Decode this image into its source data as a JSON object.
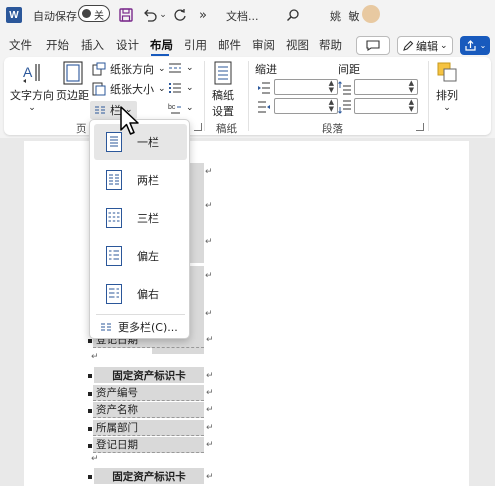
{
  "titlebar": {
    "app_logo": "W",
    "autosave_label": "自动保存",
    "autosave_state": "关",
    "doc_title": "文档...",
    "user_name": "姚 敏",
    "more_glyph": "»",
    "icons": [
      "save-icon",
      "undo-icon",
      "redo-icon",
      "search-icon"
    ]
  },
  "tabs": [
    "文件",
    "开始",
    "插入",
    "设计",
    "布局",
    "引用",
    "邮件",
    "审阅",
    "视图",
    "帮助"
  ],
  "active_tab": "布局",
  "top_buttons": {
    "edit_label": "编辑"
  },
  "ribbon": {
    "text_direction": "文字方向",
    "margins": "页边距",
    "orientation": "纸张方向",
    "size": "纸张大小",
    "columns": "栏",
    "page_setup_label": "页",
    "draft_paper": "稿纸\n设置",
    "draft_paper_line1": "稿纸",
    "draft_paper_line2": "设置",
    "draft_group_label": "稿纸",
    "indent_label": "缩进",
    "spacing_label": "间距",
    "paragraph_label": "段落",
    "arrange_label": "排列"
  },
  "columns_menu": {
    "items": [
      {
        "label": "一栏",
        "selected": true
      },
      {
        "label": "两栏",
        "selected": false
      },
      {
        "label": "三栏",
        "selected": false
      },
      {
        "label": "偏左",
        "selected": false
      },
      {
        "label": "偏右",
        "selected": false
      }
    ],
    "more_label": "更多栏(C)..."
  },
  "document": {
    "card_title": "固定资产标识卡",
    "fields": [
      "资产编号",
      "资产名称",
      "所属部门",
      "登记日期"
    ],
    "partial_field": "登记日期"
  },
  "colors": {
    "accent": "#185abd",
    "word_blue": "#2b579a"
  }
}
